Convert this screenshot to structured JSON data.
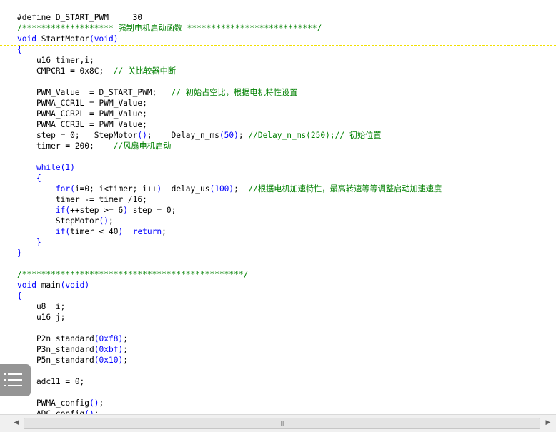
{
  "code_lines": [
    [
      {
        "t": "#define D_START_PWM     30",
        "c": ""
      }
    ],
    [
      {
        "t": "/******************* 强制电机启动函数 ***************************/",
        "c": "cm"
      }
    ],
    [
      {
        "t": "void",
        "c": "kw"
      },
      {
        "t": " StartMotor",
        "c": ""
      },
      {
        "t": "(void)",
        "c": "kw"
      }
    ],
    [
      {
        "t": "{",
        "c": "kw"
      }
    ],
    [
      {
        "t": "    u16 timer,i;",
        "c": ""
      }
    ],
    [
      {
        "t": "    CMPCR1 = 0x8C;  ",
        "c": ""
      },
      {
        "t": "// 关比较器中断",
        "c": "cm"
      }
    ],
    [
      {
        "t": "",
        "c": ""
      }
    ],
    [
      {
        "t": "    PWM_Value  = D_START_PWM;   ",
        "c": ""
      },
      {
        "t": "// 初始占空比，根据电机特性设置",
        "c": "cm"
      }
    ],
    [
      {
        "t": "    PWMA_CCR1L = PWM_Value;",
        "c": ""
      }
    ],
    [
      {
        "t": "    PWMA_CCR2L = PWM_Value;",
        "c": ""
      }
    ],
    [
      {
        "t": "    PWMA_CCR3L = PWM_Value;",
        "c": ""
      }
    ],
    [
      {
        "t": "    step = 0;   StepMotor",
        "c": ""
      },
      {
        "t": "()",
        "c": "kw"
      },
      {
        "t": ";    Delay_n_ms",
        "c": ""
      },
      {
        "t": "(50)",
        "c": "kw"
      },
      {
        "t": "; ",
        "c": ""
      },
      {
        "t": "//Delay_n_ms(250);// 初始位置",
        "c": "cm"
      }
    ],
    [
      {
        "t": "    timer = 200;    ",
        "c": ""
      },
      {
        "t": "//风扇电机启动",
        "c": "cm"
      }
    ],
    [
      {
        "t": "",
        "c": ""
      }
    ],
    [
      {
        "t": "    ",
        "c": ""
      },
      {
        "t": "while(1)",
        "c": "kw"
      }
    ],
    [
      {
        "t": "    {",
        "c": "kw"
      }
    ],
    [
      {
        "t": "        ",
        "c": ""
      },
      {
        "t": "for(",
        "c": "kw"
      },
      {
        "t": "i=0; i<timer; i++",
        "c": ""
      },
      {
        "t": ")",
        "c": "kw"
      },
      {
        "t": "  delay_us",
        "c": ""
      },
      {
        "t": "(100)",
        "c": "kw"
      },
      {
        "t": ";  ",
        "c": ""
      },
      {
        "t": "//根据电机加速特性，最高转速等等调整启动加速速度",
        "c": "cm"
      }
    ],
    [
      {
        "t": "        timer -= timer /16;",
        "c": ""
      }
    ],
    [
      {
        "t": "        ",
        "c": ""
      },
      {
        "t": "if(",
        "c": "kw"
      },
      {
        "t": "++step >= 6",
        "c": ""
      },
      {
        "t": ")",
        "c": "kw"
      },
      {
        "t": " step = 0;",
        "c": ""
      }
    ],
    [
      {
        "t": "        StepMotor",
        "c": ""
      },
      {
        "t": "()",
        "c": "kw"
      },
      {
        "t": ";",
        "c": ""
      }
    ],
    [
      {
        "t": "        ",
        "c": ""
      },
      {
        "t": "if(",
        "c": "kw"
      },
      {
        "t": "timer < 40",
        "c": ""
      },
      {
        "t": ")",
        "c": "kw"
      },
      {
        "t": "  ",
        "c": ""
      },
      {
        "t": "return",
        "c": "kw"
      },
      {
        "t": ";",
        "c": ""
      }
    ],
    [
      {
        "t": "    }",
        "c": "kw"
      }
    ],
    [
      {
        "t": "}",
        "c": "kw"
      }
    ],
    [
      {
        "t": "",
        "c": ""
      }
    ],
    [
      {
        "t": "/**********************************************/",
        "c": "cm"
      }
    ],
    [
      {
        "t": "void",
        "c": "kw"
      },
      {
        "t": " main",
        "c": ""
      },
      {
        "t": "(void)",
        "c": "kw"
      }
    ],
    [
      {
        "t": "{",
        "c": "kw"
      }
    ],
    [
      {
        "t": "    u8  i;",
        "c": ""
      }
    ],
    [
      {
        "t": "    u16 j;",
        "c": ""
      }
    ],
    [
      {
        "t": "",
        "c": ""
      }
    ],
    [
      {
        "t": "    P2n_standard",
        "c": ""
      },
      {
        "t": "(0xf8)",
        "c": "kw"
      },
      {
        "t": ";",
        "c": ""
      }
    ],
    [
      {
        "t": "    P3n_standard",
        "c": ""
      },
      {
        "t": "(0xbf)",
        "c": "kw"
      },
      {
        "t": ";",
        "c": ""
      }
    ],
    [
      {
        "t": "    P5n_standard",
        "c": ""
      },
      {
        "t": "(0x10)",
        "c": "kw"
      },
      {
        "t": ";",
        "c": ""
      }
    ],
    [
      {
        "t": "",
        "c": ""
      }
    ],
    [
      {
        "t": "    adc11 = 0;",
        "c": ""
      }
    ],
    [
      {
        "t": "",
        "c": ""
      }
    ],
    [
      {
        "t": "    PWMA_config",
        "c": ""
      },
      {
        "t": "()",
        "c": "kw"
      },
      {
        "t": ";",
        "c": ""
      }
    ],
    [
      {
        "t": "    ADC_config",
        "c": ""
      },
      {
        "t": "()",
        "c": "kw"
      },
      {
        "t": ";",
        "c": ""
      }
    ]
  ],
  "scrollbar": {
    "left_arrow": "◀",
    "right_arrow": "▶",
    "grip": "|||"
  },
  "icons": {
    "menu_float": "list-menu-icon"
  }
}
